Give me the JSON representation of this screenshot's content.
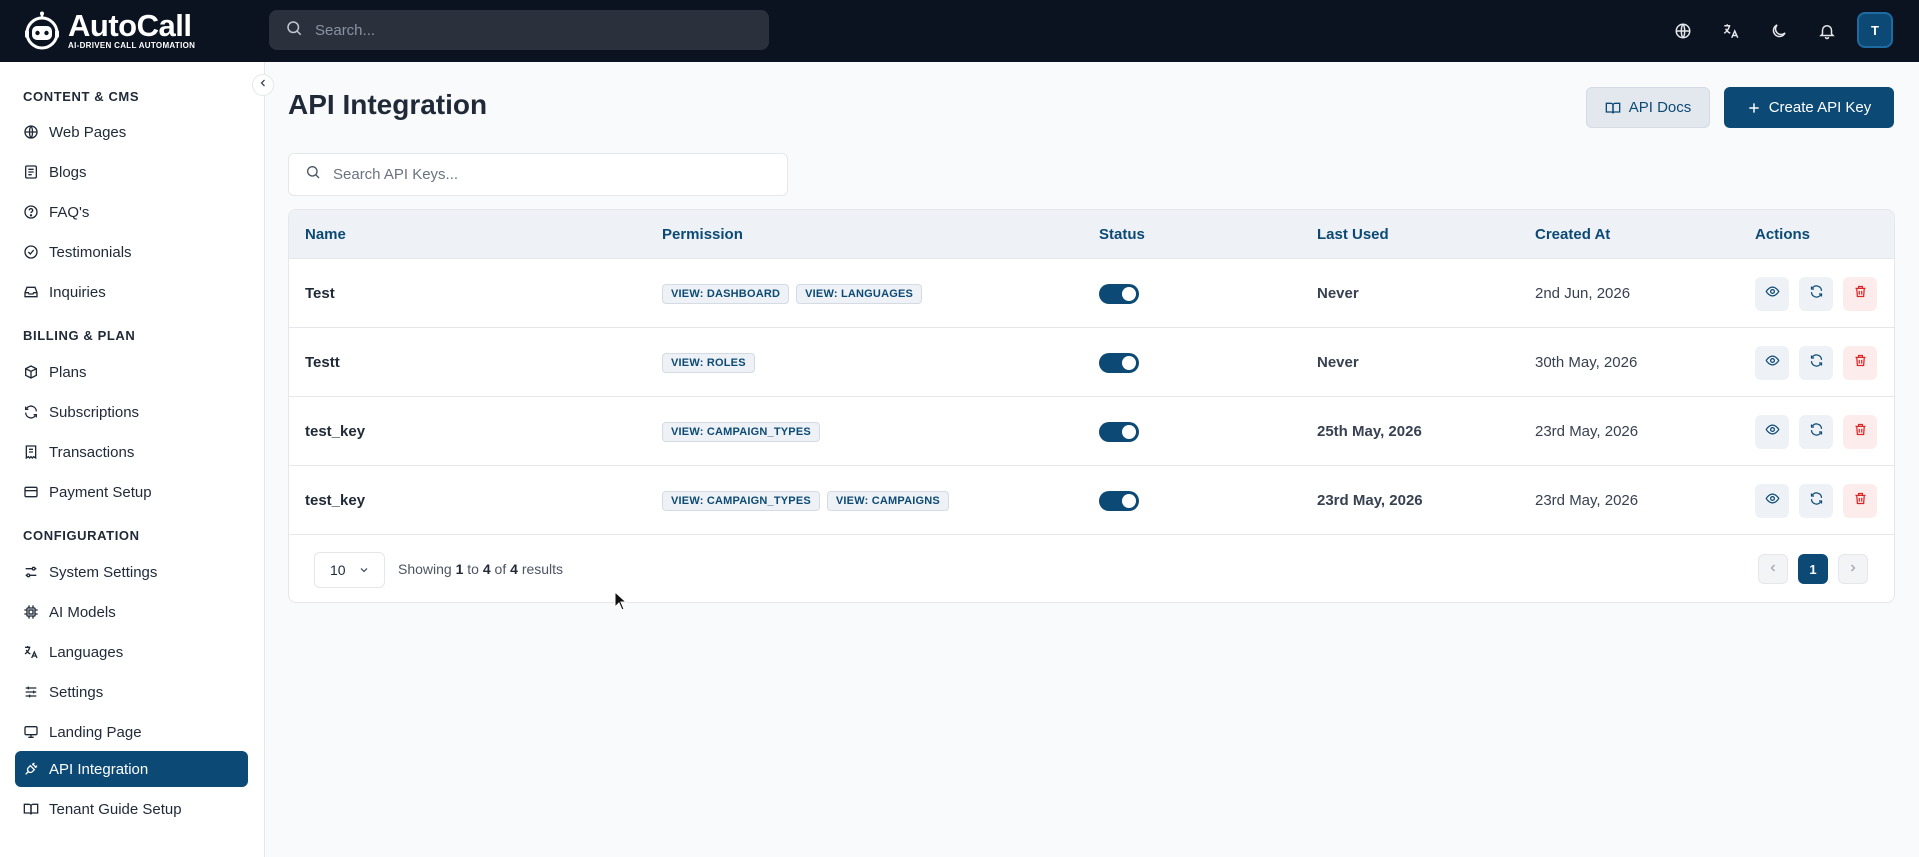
{
  "app": {
    "logo_title": "AutoCall",
    "logo_subtitle": "AI-DRIVEN CALL AUTOMATION",
    "search_placeholder": "Search...",
    "avatar_initial": "T"
  },
  "sidebar": {
    "sections": [
      {
        "title": "CONTENT & CMS",
        "items": [
          {
            "label": "Web Pages",
            "icon": "globe-icon"
          },
          {
            "label": "Blogs",
            "icon": "newspaper-icon"
          },
          {
            "label": "FAQ's",
            "icon": "help-circle-icon"
          },
          {
            "label": "Testimonials",
            "icon": "check-circle-icon"
          },
          {
            "label": "Inquiries",
            "icon": "inbox-icon"
          }
        ]
      },
      {
        "title": "BILLING & PLAN",
        "items": [
          {
            "label": "Plans",
            "icon": "package-icon"
          },
          {
            "label": "Subscriptions",
            "icon": "refresh-icon"
          },
          {
            "label": "Transactions",
            "icon": "receipt-icon"
          },
          {
            "label": "Payment Setup",
            "icon": "credit-card-icon"
          }
        ]
      },
      {
        "title": "CONFIGURATION",
        "items": [
          {
            "label": "System Settings",
            "icon": "settings-sliders-icon"
          },
          {
            "label": "AI Models",
            "icon": "cpu-icon"
          },
          {
            "label": "Languages",
            "icon": "translate-icon"
          },
          {
            "label": "Settings",
            "icon": "sliders-icon"
          },
          {
            "label": "Landing Page",
            "icon": "monitor-icon"
          },
          {
            "label": "API Integration",
            "icon": "plug-icon",
            "active": true
          },
          {
            "label": "Tenant Guide Setup",
            "icon": "book-icon"
          }
        ]
      }
    ]
  },
  "main": {
    "title": "API Integration",
    "api_docs_label": "API Docs",
    "create_label": "Create API Key",
    "search_placeholder": "Search API Keys...",
    "columns": [
      "Name",
      "Permission",
      "Status",
      "Last Used",
      "Created At",
      "Actions"
    ],
    "rows": [
      {
        "name": "Test",
        "permissions": [
          "VIEW: DASHBOARD",
          "VIEW: LANGUAGES"
        ],
        "status": true,
        "last_used": "Never",
        "created_at": "2nd Jun, 2026"
      },
      {
        "name": "Testt",
        "permissions": [
          "VIEW: ROLES"
        ],
        "status": true,
        "last_used": "Never",
        "created_at": "30th May, 2026"
      },
      {
        "name": "test_key",
        "permissions": [
          "VIEW: CAMPAIGN_TYPES"
        ],
        "status": true,
        "last_used": "25th May, 2026",
        "created_at": "23rd May, 2026"
      },
      {
        "name": "test_key",
        "permissions": [
          "VIEW: CAMPAIGN_TYPES",
          "VIEW: CAMPAIGNS"
        ],
        "status": true,
        "last_used": "23rd May, 2026",
        "created_at": "23rd May, 2026"
      }
    ],
    "pagination": {
      "per_page": "10",
      "showing_prefix": "Showing",
      "from": "1",
      "to_word": "to",
      "to": "4",
      "of_word": "of",
      "total": "4",
      "results_word": "results",
      "current_page": "1"
    }
  },
  "colors": {
    "brand": "#0c4a75",
    "topbar": "#0b1220",
    "delete": "#dc2626"
  }
}
